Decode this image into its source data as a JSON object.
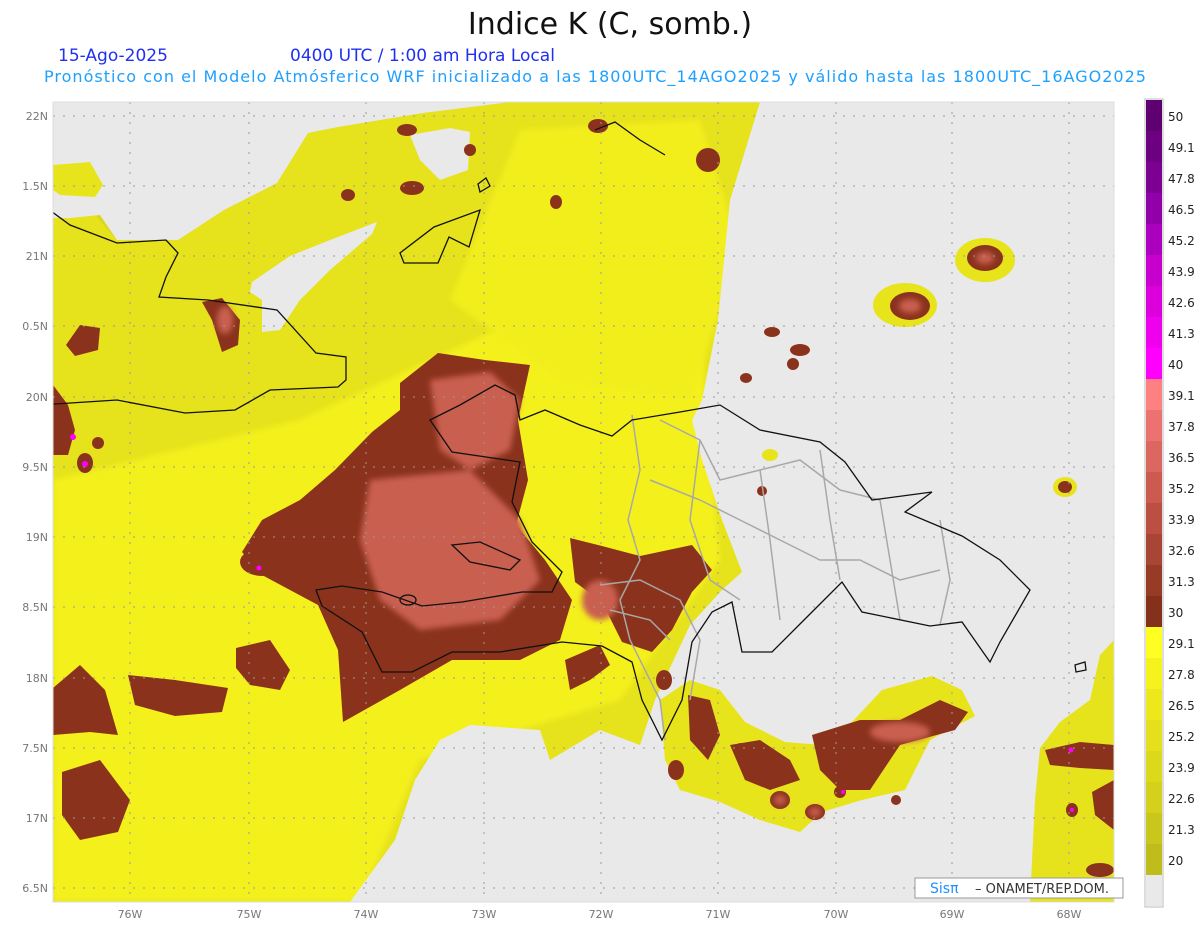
{
  "header": {
    "title": "Indice K (C, somb.)",
    "date": "15-Ago-2025",
    "time": "0400 UTC / 1:00 am Hora Local",
    "forecast_info": "Pronóstico con el Modelo Atmósferico WRF inicializado a las 1800UTC_14AGO2025 y válido hasta las  1800UTC_16AGO2025"
  },
  "map": {
    "lat_labels": [
      "22N",
      "1.5N",
      "21N",
      "0.5N",
      "20N",
      "9.5N",
      "19N",
      "8.5N",
      "18N",
      "7.5N",
      "17N",
      "6.5N"
    ],
    "lon_labels": [
      "76W",
      "75W",
      "74W",
      "73W",
      "72W",
      "71W",
      "70W",
      "69W",
      "68W"
    ],
    "credit": {
      "brand": "Sisπ",
      "text": "– ONAMET/REP.DOM."
    }
  },
  "colorbar": {
    "labels": [
      "50",
      "49.1",
      "47.8",
      "46.5",
      "45.2",
      "43.9",
      "42.6",
      "41.3",
      "40",
      "39.1",
      "37.8",
      "36.5",
      "35.2",
      "33.9",
      "32.6",
      "31.3",
      "30",
      "29.1",
      "27.8",
      "26.5",
      "25.2",
      "23.9",
      "22.6",
      "21.3",
      "20"
    ],
    "colors": [
      "#5e0070",
      "#6c0080",
      "#7c0092",
      "#9200aa",
      "#ab00bd",
      "#c800cd",
      "#dc00dc",
      "#ee00ee",
      "#ff00ff",
      "#ff8080",
      "#ec7272",
      "#dc6660",
      "#cc5a4e",
      "#bb5042",
      "#a94534",
      "#973a26",
      "#85301a",
      "#ffff22",
      "#f6f21e",
      "#ece81c",
      "#e4e01c",
      "#dcd81c",
      "#d4d01c",
      "#c9c61c",
      "#bfbc1c",
      "#e9e9e9"
    ]
  },
  "colors": {
    "low": "#e9e9e9",
    "yellow": "#e8e41c",
    "brown_dark": "#8a321c",
    "brown_light": "#c85e50",
    "magenta": "#ff00ff"
  }
}
